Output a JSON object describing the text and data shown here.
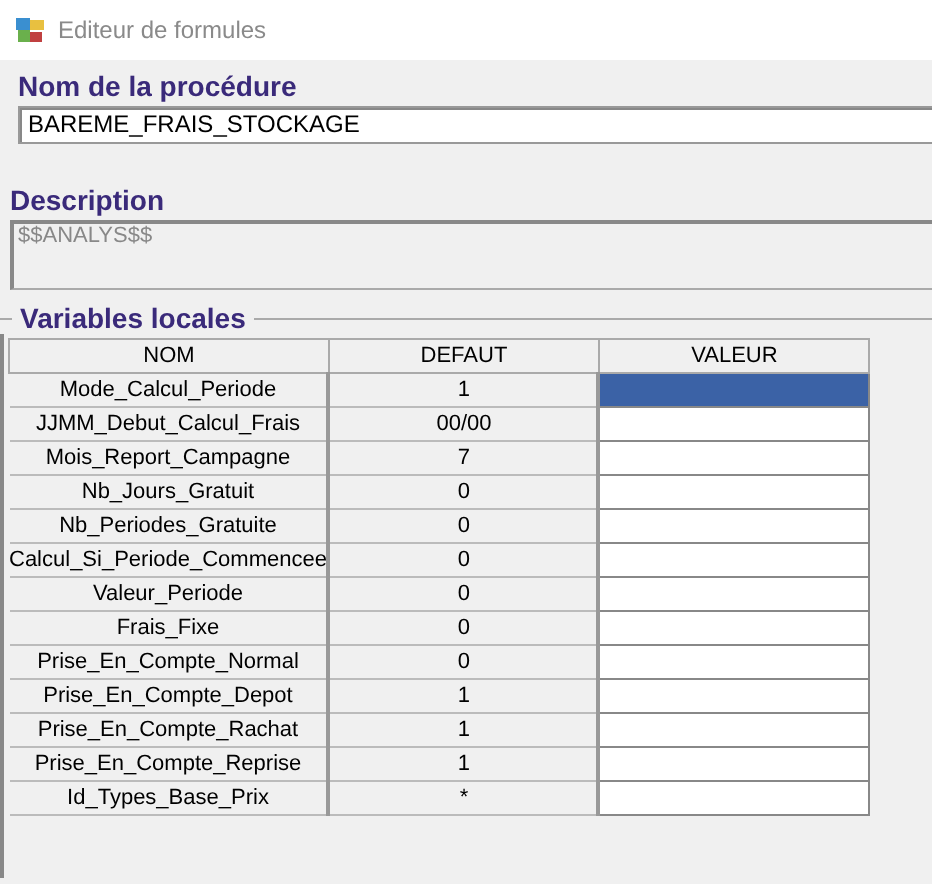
{
  "window": {
    "title": "Editeur de formules"
  },
  "procedure": {
    "label": "Nom de la procédure",
    "value": "BAREME_FRAIS_STOCKAGE"
  },
  "description": {
    "label": "Description",
    "value": "$$ANALYS$$"
  },
  "variables": {
    "title": "Variables locales",
    "columns": [
      "NOM",
      "DEFAUT",
      "VALEUR"
    ],
    "rows": [
      {
        "name": "Mode_Calcul_Periode",
        "default": "1",
        "selected": true
      },
      {
        "name": "JJMM_Debut_Calcul_Frais",
        "default": "00/00",
        "selected": false
      },
      {
        "name": "Mois_Report_Campagne",
        "default": "7",
        "selected": false
      },
      {
        "name": "Nb_Jours_Gratuit",
        "default": "0",
        "selected": false
      },
      {
        "name": "Nb_Periodes_Gratuite",
        "default": "0",
        "selected": false
      },
      {
        "name": "Calcul_Si_Periode_Commencee",
        "default": "0",
        "selected": false
      },
      {
        "name": "Valeur_Periode",
        "default": "0",
        "selected": false
      },
      {
        "name": "Frais_Fixe",
        "default": "0",
        "selected": false
      },
      {
        "name": "Prise_En_Compte_Normal",
        "default": "0",
        "selected": false
      },
      {
        "name": "Prise_En_Compte_Depot",
        "default": "1",
        "selected": false
      },
      {
        "name": "Prise_En_Compte_Rachat",
        "default": "1",
        "selected": false
      },
      {
        "name": "Prise_En_Compte_Reprise",
        "default": "1",
        "selected": false
      },
      {
        "name": "Id_Types_Base_Prix",
        "default": "*",
        "selected": false
      }
    ]
  }
}
